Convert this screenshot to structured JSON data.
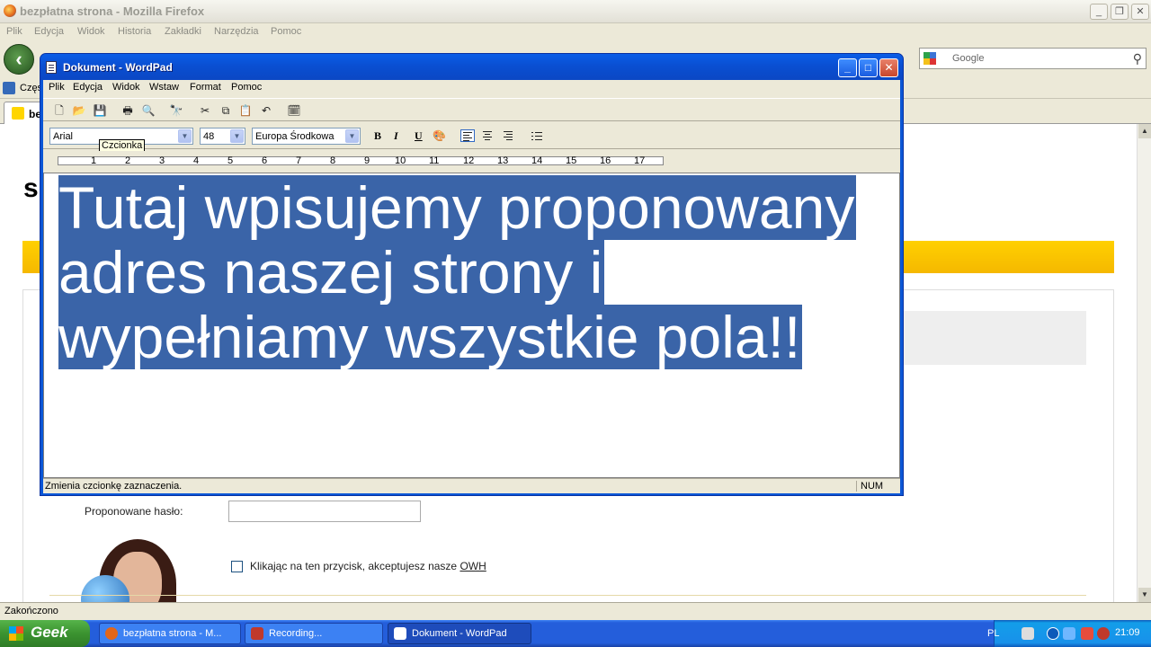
{
  "firefox": {
    "title": "bezpłatna strona - Mozilla Firefox",
    "menu": [
      "Plik",
      "Edycja",
      "Widok",
      "Historia",
      "Zakładki",
      "Narzędzia",
      "Pomoc"
    ],
    "search_placeholder": "Google",
    "bookmark_label": "Częs",
    "tab_label": "be",
    "status": "Zakończono"
  },
  "page": {
    "logo_partial": "s",
    "password_label": "Proponowane hasło:",
    "accept_text": "Klikając na ten przycisk, akceptujesz nasze ",
    "accept_link": "OWH"
  },
  "wordpad": {
    "title": "Dokument - WordPad",
    "menu": [
      "Plik",
      "Edycja",
      "Widok",
      "Wstaw",
      "Format",
      "Pomoc"
    ],
    "font": "Arial",
    "size": "48",
    "script": "Europa Środkowa",
    "tooltip": "Czcionka",
    "ruler_numbers": [
      "1",
      "2",
      "3",
      "4",
      "5",
      "6",
      "7",
      "8",
      "9",
      "10",
      "11",
      "12",
      "13",
      "14",
      "15",
      "16",
      "17"
    ],
    "text_lines": [
      "Tutaj wpisujemy proponowany",
      "adres naszej strony i",
      "wypełniamy wszystkie pola!!"
    ],
    "status_text": "Zmienia czcionkę zaznaczenia.",
    "num_indicator": "NUM"
  },
  "taskbar": {
    "start_label": "Geek",
    "items": [
      {
        "label": "bezpłatna strona - M...",
        "icon": "firefox-icon",
        "color": "#e2661a"
      },
      {
        "label": "Recording...",
        "icon": "recording-icon",
        "color": "#c0392b"
      },
      {
        "label": "Dokument - WordPad",
        "icon": "wordpad-icon",
        "color": "#ffffff"
      }
    ],
    "lang": "PL",
    "clock": "21:09"
  }
}
